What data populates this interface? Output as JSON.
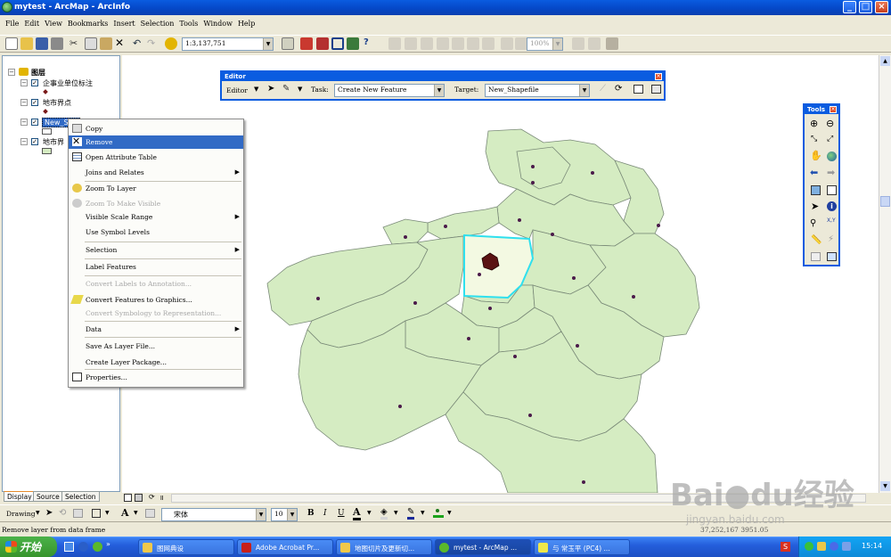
{
  "window": {
    "title": "mytest - ArcMap - ArcInfo",
    "min": "_",
    "max": "□",
    "close": "×"
  },
  "menu": [
    "File",
    "Edit",
    "View",
    "Bookmarks",
    "Insert",
    "Selection",
    "Tools",
    "Window",
    "Help"
  ],
  "standard_toolbar": {
    "scale": "1:3,137,751"
  },
  "zoom_box": "100%",
  "toc": {
    "root": "图层",
    "layers": [
      {
        "name": "企事业单位标注"
      },
      {
        "name": "地市界点"
      },
      {
        "name": "New_Shapefile",
        "shown": "New_Sha"
      },
      {
        "name": "地市界"
      }
    ]
  },
  "context_menu": [
    {
      "label": "Copy"
    },
    {
      "label": "Remove",
      "selected": true
    },
    {
      "label": "Open Attribute Table"
    },
    {
      "label": "Joins and Relates",
      "submenu": true
    },
    {
      "label": "Zoom To Layer"
    },
    {
      "label": "Zoom To Make Visible",
      "disabled": true
    },
    {
      "label": "Visible Scale Range",
      "submenu": true
    },
    {
      "label": "Use Symbol Levels"
    },
    {
      "label": "Selection",
      "submenu": true
    },
    {
      "label": "Label Features"
    },
    {
      "label": "Convert Labels to Annotation...",
      "disabled": true
    },
    {
      "label": "Convert Features to Graphics..."
    },
    {
      "label": "Convert Symbology to Representation...",
      "disabled": true
    },
    {
      "label": "Data",
      "submenu": true
    },
    {
      "label": "Save As Layer File..."
    },
    {
      "label": "Create Layer Package..."
    },
    {
      "label": "Properties..."
    }
  ],
  "editor": {
    "title": "Editor",
    "menu": "Editor",
    "task_label": "Task:",
    "task_value": "Create New Feature",
    "target_label": "Target:",
    "target_value": "New_Shapefile"
  },
  "tools": {
    "title": "Tools"
  },
  "toc_tabs": [
    "Display",
    "Source",
    "Selection"
  ],
  "draw_toolbar": {
    "drawing": "Drawing",
    "font": "宋体",
    "size": "10",
    "bold": "B",
    "italic": "I",
    "underline": "U"
  },
  "status": {
    "message": "Remove layer from data frame",
    "coords": "37,252,167  3951.05"
  },
  "taskbar": {
    "start": "开始",
    "items": [
      "图网典设",
      "Adobe Acrobat Pr...",
      "地图切片及更新切...",
      "mytest - ArcMap ...",
      "与 常玉平 (PC4) ..."
    ],
    "time": "15:14"
  },
  "watermark": {
    "brand": "Bai",
    "brand2": "du",
    "brand3": "经验",
    "url": "jingyan.baidu.com"
  },
  "colors": {
    "map_fill": "#d5ecc2",
    "map_stroke": "#7a8a78",
    "selected_outline": "#2fe0ee",
    "point": "#4a1a4a",
    "xp_blue": "#0a5ce0"
  }
}
